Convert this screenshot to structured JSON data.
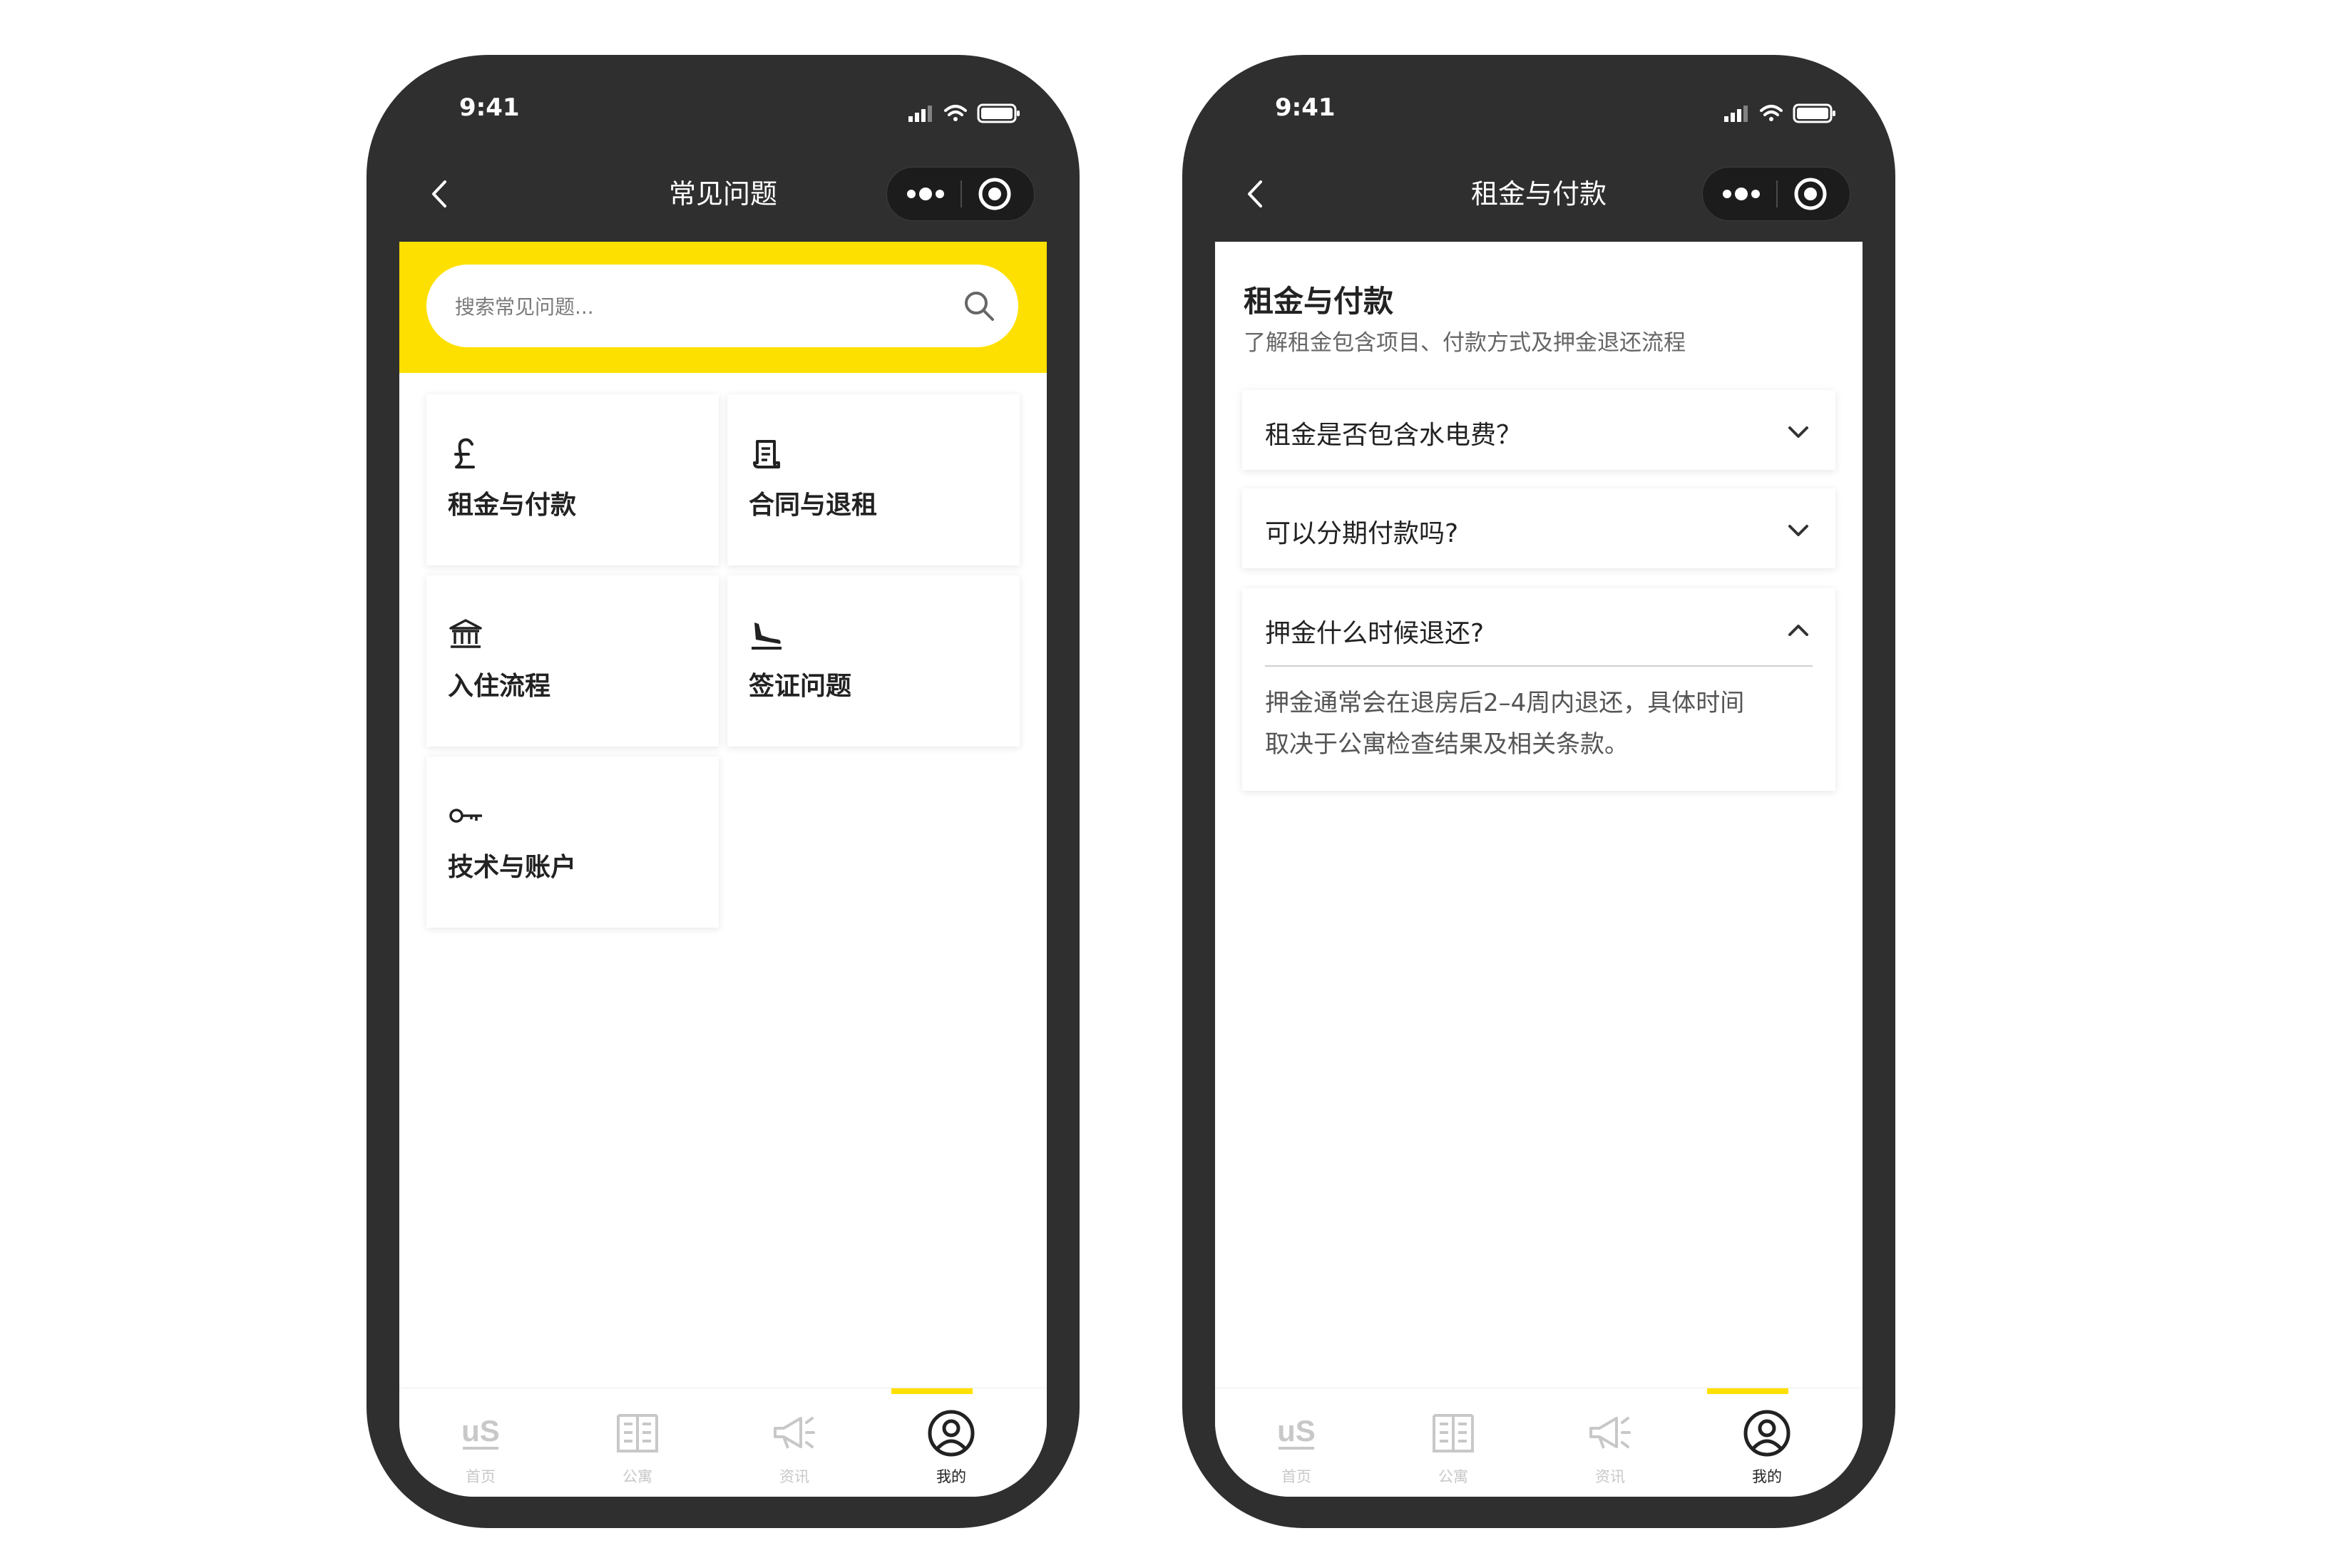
{
  "status_time": "9:41",
  "accent_color": "#fee000",
  "left": {
    "nav_title": "常见问题",
    "search_placeholder": "搜索常见问题...",
    "categories": [
      {
        "icon": "pound-icon",
        "label": "租金与付款"
      },
      {
        "icon": "document-icon",
        "label": "合同与退租"
      },
      {
        "icon": "bank-icon",
        "label": "入住流程"
      },
      {
        "icon": "plane-landing-icon",
        "label": "签证问题"
      },
      {
        "icon": "key-icon",
        "label": "技术与账户"
      }
    ]
  },
  "right": {
    "nav_title": "租金与付款",
    "section_title": "租金与付款",
    "section_subtitle": "了解租金包含项目、付款方式及押金退还流程",
    "faqs": [
      {
        "question": "租金是否包含水电费？",
        "expanded": false
      },
      {
        "question": "可以分期付款吗?",
        "expanded": false
      },
      {
        "question": "押金什么时候退还?",
        "expanded": true,
        "answer_line1": "押金通常会在退房后2–4周内退还，具体时间",
        "answer_line2": "取决于公寓检查结果及相关条款。"
      }
    ]
  },
  "tabbar": [
    {
      "label": "首页",
      "icon": "us-logo-icon",
      "active": false
    },
    {
      "label": "公寓",
      "icon": "building-icon",
      "active": false
    },
    {
      "label": "资讯",
      "icon": "megaphone-icon",
      "active": false
    },
    {
      "label": "我的",
      "icon": "user-circle-icon",
      "active": true
    }
  ]
}
